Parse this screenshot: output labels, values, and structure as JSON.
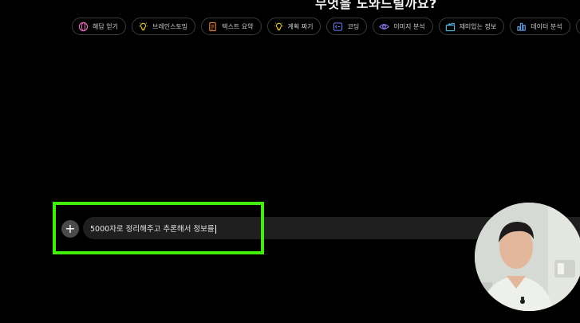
{
  "header": {
    "heading_fragment": "무엇을 도와드릴까요?"
  },
  "chips": [
    {
      "label": "해답 얻기",
      "icon": "globe-icon",
      "color": "#e06ab8"
    },
    {
      "label": "브레인스토밍",
      "icon": "lightbulb-icon",
      "color": "#e8c43a"
    },
    {
      "label": "텍스트 요약",
      "icon": "document-icon",
      "color": "#e8823a"
    },
    {
      "label": "계획 짜기",
      "icon": "lightbulb-icon",
      "color": "#e8c43a"
    },
    {
      "label": "코딩",
      "icon": "code-icon",
      "color": "#6a7cf0"
    },
    {
      "label": "이미지 분석",
      "icon": "eye-icon",
      "color": "#8a7cf0"
    },
    {
      "label": "재미있는 정보",
      "icon": "clapperboard-icon",
      "color": "#59b8e8"
    },
    {
      "label": "데이터 분석",
      "icon": "bar-chart-icon",
      "color": "#6aa8f0"
    },
    {
      "label": "",
      "icon": "pen-icon",
      "color": "#c06af0"
    }
  ],
  "composer": {
    "input_value": "5000자로 정리해주고 추론해서 정보를",
    "plus_symbol": "+"
  },
  "colors": {
    "background": "#000000",
    "input_bg": "#1f1f1f",
    "highlight": "#44ee0c"
  }
}
